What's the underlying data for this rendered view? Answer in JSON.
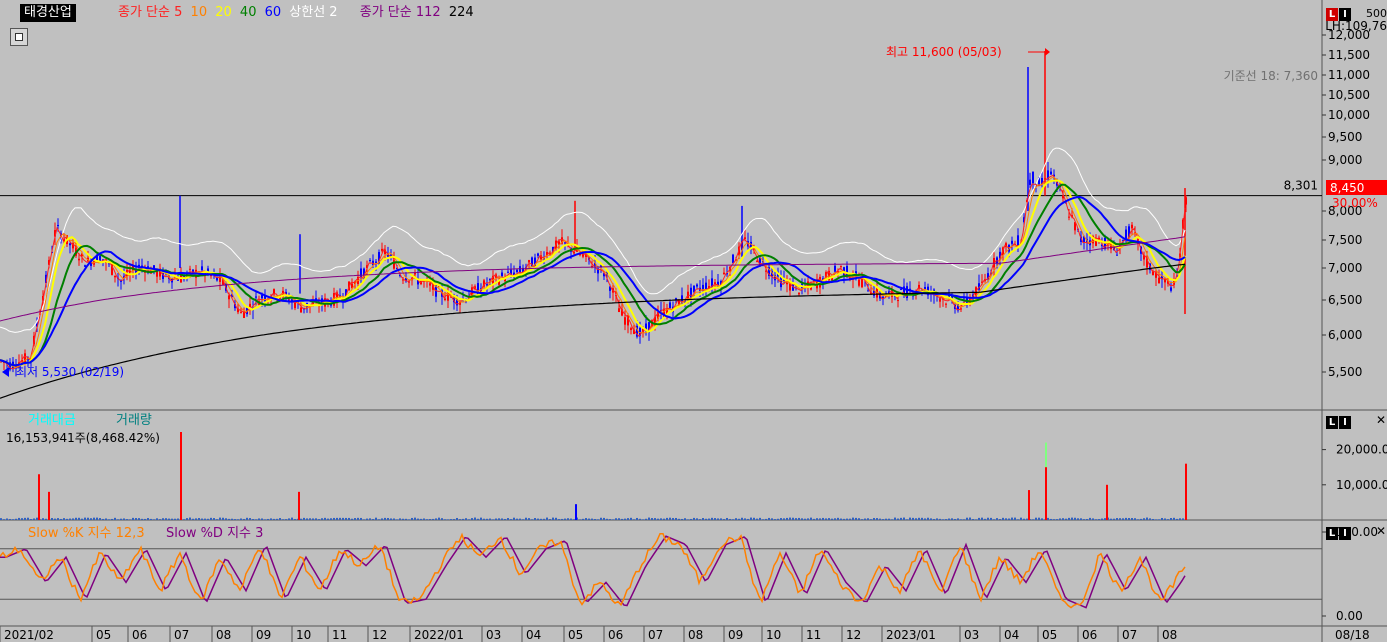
{
  "header": {
    "stock_name": "태경산업",
    "ma_prefix": "종가 단순",
    "ma_periods": [
      {
        "label": "5",
        "color": "#ff2020"
      },
      {
        "label": "10",
        "color": "#ff8000"
      },
      {
        "label": "20",
        "color": "#ffff00"
      },
      {
        "label": "40",
        "color": "#008000"
      },
      {
        "label": "60",
        "color": "#0000ff"
      }
    ],
    "band_label": "상한선 2",
    "long_ma_prefix": "종가 단순",
    "long_ma_periods": [
      {
        "label": "112",
        "color": "#800080"
      },
      {
        "label": "224",
        "color": "#000000"
      }
    ]
  },
  "right_panel": {
    "price_top_label": "LH:109,76",
    "price_top_extra": "500",
    "ichimoku_baseline": "기준선 18: 7,360",
    "current_price": "8,450",
    "current_pct": "30.00%",
    "hline_value": "8,301"
  },
  "annotations": {
    "high": "최고 11,600 (05/03)",
    "low": "최저 5,530 (02/19)"
  },
  "volume_panel": {
    "labels": [
      {
        "text": "거래대금",
        "color": "#00ffff"
      },
      {
        "text": "거래량",
        "color": "#008080"
      }
    ],
    "value_text": "16,153,941주(8,468.42%)",
    "ticks": [
      "20,000.0",
      "10,000.0"
    ]
  },
  "stoch_panel": {
    "label_k": "Slow %K 지수 12,3",
    "label_d": "Slow %D 지수 3",
    "ticks": [
      "100.00",
      "0.00"
    ]
  },
  "x_labels": [
    "2021/02",
    "05",
    "06",
    "07",
    "08",
    "09",
    "10",
    "11",
    "12",
    "2022/01",
    "03",
    "04",
    "05",
    "06",
    "07",
    "08",
    "09",
    "10",
    "11",
    "12",
    "2023/01",
    "03",
    "04",
    "05",
    "06",
    "07",
    "08"
  ],
  "x_label_right": "08/18",
  "colors": {
    "background": "#c0c0c0",
    "up": "#ff0000",
    "down": "#0000ff",
    "ma5": "#ff2020",
    "ma10": "#ff8000",
    "ma20": "#ffff00",
    "ma40": "#008000",
    "ma60": "#0000ff",
    "ma112": "#800080",
    "ma224": "#000000",
    "band": "#ffffff",
    "volume": "#3060c0",
    "stoch_k": "#ff8000",
    "stoch_d": "#800080"
  },
  "chart_data": [
    {
      "type": "line",
      "panel": "price",
      "ylim": [
        5100,
        12500
      ],
      "yticks": [
        12000,
        11500,
        11000,
        10500,
        10000,
        9500,
        9000,
        8000,
        7500,
        7000,
        6500,
        6000,
        5500
      ],
      "ytick_labels": [
        "12,000",
        "11,500",
        "11,000",
        "10,500",
        "10,000",
        "9,500",
        "9,000",
        "8,000",
        "7,500",
        "7,000",
        "6,500",
        "6,000",
        "5,500"
      ],
      "hline": 8301,
      "price_keypoints": [
        [
          0,
          5650
        ],
        [
          10,
          5600
        ],
        [
          30,
          5700
        ],
        [
          45,
          6800
        ],
        [
          55,
          7700
        ],
        [
          70,
          7400
        ],
        [
          85,
          7100
        ],
        [
          100,
          7200
        ],
        [
          120,
          6800
        ],
        [
          140,
          7050
        ],
        [
          160,
          6900
        ],
        [
          180,
          6850
        ],
        [
          200,
          6950
        ],
        [
          220,
          6800
        ],
        [
          240,
          6300
        ],
        [
          260,
          6550
        ],
        [
          280,
          6600
        ],
        [
          300,
          6400
        ],
        [
          320,
          6450
        ],
        [
          340,
          6550
        ],
        [
          360,
          6900
        ],
        [
          385,
          7300
        ],
        [
          400,
          6900
        ],
        [
          420,
          6800
        ],
        [
          440,
          6600
        ],
        [
          460,
          6500
        ],
        [
          480,
          6700
        ],
        [
          500,
          6850
        ],
        [
          520,
          6950
        ],
        [
          540,
          7200
        ],
        [
          560,
          7450
        ],
        [
          575,
          7300
        ],
        [
          590,
          7100
        ],
        [
          605,
          6900
        ],
        [
          620,
          6300
        ],
        [
          640,
          6000
        ],
        [
          660,
          6300
        ],
        [
          680,
          6500
        ],
        [
          700,
          6700
        ],
        [
          720,
          6800
        ],
        [
          745,
          7500
        ],
        [
          760,
          7100
        ],
        [
          780,
          6800
        ],
        [
          800,
          6650
        ],
        [
          820,
          6800
        ],
        [
          840,
          7000
        ],
        [
          860,
          6800
        ],
        [
          880,
          6550
        ],
        [
          900,
          6600
        ],
        [
          920,
          6700
        ],
        [
          940,
          6550
        ],
        [
          960,
          6400
        ],
        [
          980,
          6700
        ],
        [
          1000,
          7300
        ],
        [
          1020,
          7500
        ],
        [
          1030,
          8700
        ],
        [
          1040,
          8500
        ],
        [
          1050,
          8800
        ],
        [
          1065,
          8100
        ],
        [
          1080,
          7500
        ],
        [
          1100,
          7500
        ],
        [
          1115,
          7300
        ],
        [
          1130,
          7700
        ],
        [
          1145,
          7100
        ],
        [
          1160,
          6800
        ],
        [
          1175,
          6700
        ],
        [
          1185,
          8200
        ]
      ],
      "stoch_keypoints": [
        [
          0,
          70
        ],
        [
          20,
          80
        ],
        [
          40,
          40
        ],
        [
          60,
          70
        ],
        [
          80,
          20
        ],
        [
          100,
          75
        ],
        [
          120,
          40
        ],
        [
          140,
          80
        ],
        [
          160,
          30
        ],
        [
          180,
          75
        ],
        [
          200,
          15
        ],
        [
          220,
          70
        ],
        [
          240,
          30
        ],
        [
          260,
          85
        ],
        [
          280,
          20
        ],
        [
          300,
          70
        ],
        [
          320,
          30
        ],
        [
          340,
          80
        ],
        [
          360,
          60
        ],
        [
          380,
          85
        ],
        [
          400,
          15
        ],
        [
          420,
          20
        ],
        [
          440,
          60
        ],
        [
          460,
          95
        ],
        [
          480,
          70
        ],
        [
          500,
          95
        ],
        [
          520,
          50
        ],
        [
          540,
          80
        ],
        [
          560,
          90
        ],
        [
          580,
          15
        ],
        [
          600,
          40
        ],
        [
          620,
          10
        ],
        [
          640,
          60
        ],
        [
          660,
          95
        ],
        [
          680,
          85
        ],
        [
          700,
          40
        ],
        [
          720,
          85
        ],
        [
          740,
          95
        ],
        [
          760,
          15
        ],
        [
          780,
          75
        ],
        [
          800,
          25
        ],
        [
          820,
          80
        ],
        [
          840,
          40
        ],
        [
          860,
          15
        ],
        [
          880,
          60
        ],
        [
          900,
          30
        ],
        [
          920,
          80
        ],
        [
          940,
          25
        ],
        [
          960,
          85
        ],
        [
          980,
          20
        ],
        [
          1000,
          70
        ],
        [
          1020,
          40
        ],
        [
          1040,
          80
        ],
        [
          1060,
          20
        ],
        [
          1080,
          10
        ],
        [
          1100,
          75
        ],
        [
          1120,
          30
        ],
        [
          1140,
          70
        ],
        [
          1160,
          15
        ],
        [
          1175,
          40
        ],
        [
          1185,
          60
        ]
      ]
    }
  ]
}
